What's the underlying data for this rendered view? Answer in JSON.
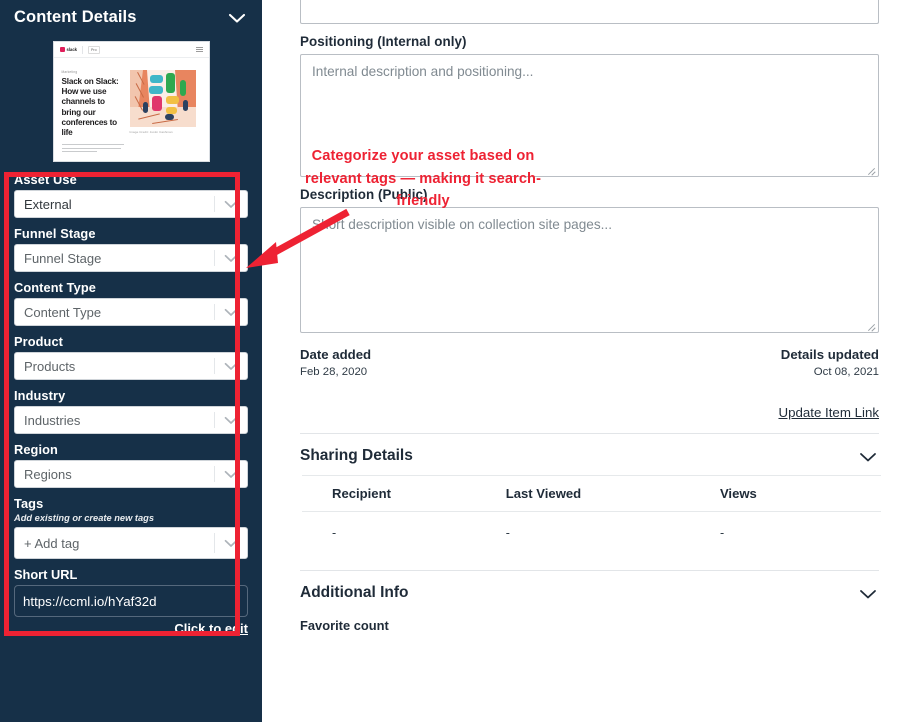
{
  "sidebar": {
    "title": "Content Details",
    "collapse_icon": "chevron-down-icon",
    "thumbnail": {
      "brand": "slack",
      "plan_badge": "Pro",
      "kicker": "Marketing",
      "headline": "Slack on Slack: How we use channels to bring our conferences to life",
      "credit": "Image Credit: Justin Cashman"
    },
    "fields": [
      {
        "label": "Asset Use",
        "value": "External",
        "filled": true,
        "caret": "chevron-down-icon"
      },
      {
        "label": "Funnel Stage",
        "value": "Funnel Stage",
        "filled": false,
        "caret": "chevron-down-icon"
      },
      {
        "label": "Content Type",
        "value": "Content Type",
        "filled": false,
        "caret": "chevron-down-icon"
      },
      {
        "label": "Product",
        "value": "Products",
        "filled": false,
        "caret": "chevron-down-icon"
      },
      {
        "label": "Industry",
        "value": "Industries",
        "filled": false,
        "caret": "chevron-down-icon"
      },
      {
        "label": "Region",
        "value": "Regions",
        "filled": false,
        "caret": "chevron-down-icon"
      }
    ],
    "tags": {
      "label": "Tags",
      "hint": "Add existing or create new tags",
      "placeholder": "+ Add tag",
      "caret": "chevron-down-icon"
    },
    "short_url": {
      "label": "Short URL",
      "value": "https://ccml.io/hYaf32d",
      "edit_link": "Click to edit"
    }
  },
  "main": {
    "positioning": {
      "label": "Positioning (Internal only)",
      "placeholder": "Internal description and positioning..."
    },
    "description": {
      "label": "Description (Public)",
      "placeholder": "Short description visible on collection site pages..."
    },
    "meta": {
      "date_added_label": "Date added",
      "date_added_value": "Feb 28, 2020",
      "details_updated_label": "Details updated",
      "details_updated_value": "Oct 08, 2021"
    },
    "update_item_link": "Update Item Link",
    "sharing": {
      "title": "Sharing Details",
      "collapse_icon": "chevron-down-icon",
      "columns": [
        "Recipient",
        "Last Viewed",
        "Views"
      ],
      "rows": [
        [
          "-",
          "-",
          "-"
        ]
      ]
    },
    "additional": {
      "title": "Additional Info",
      "collapse_icon": "chevron-down-icon",
      "favorite_count_label": "Favorite count"
    }
  },
  "annotation": {
    "text": "Categorize your asset based on relevant tags — making it search-friendly",
    "color": "#ee2233",
    "highlight_box": "red-rectangle",
    "pointer": "arrow-icon"
  },
  "colors": {
    "sidebar_bg": "#163048",
    "accent_red": "#ee2233",
    "text_dark": "#1f2b38",
    "placeholder": "#808a91"
  }
}
